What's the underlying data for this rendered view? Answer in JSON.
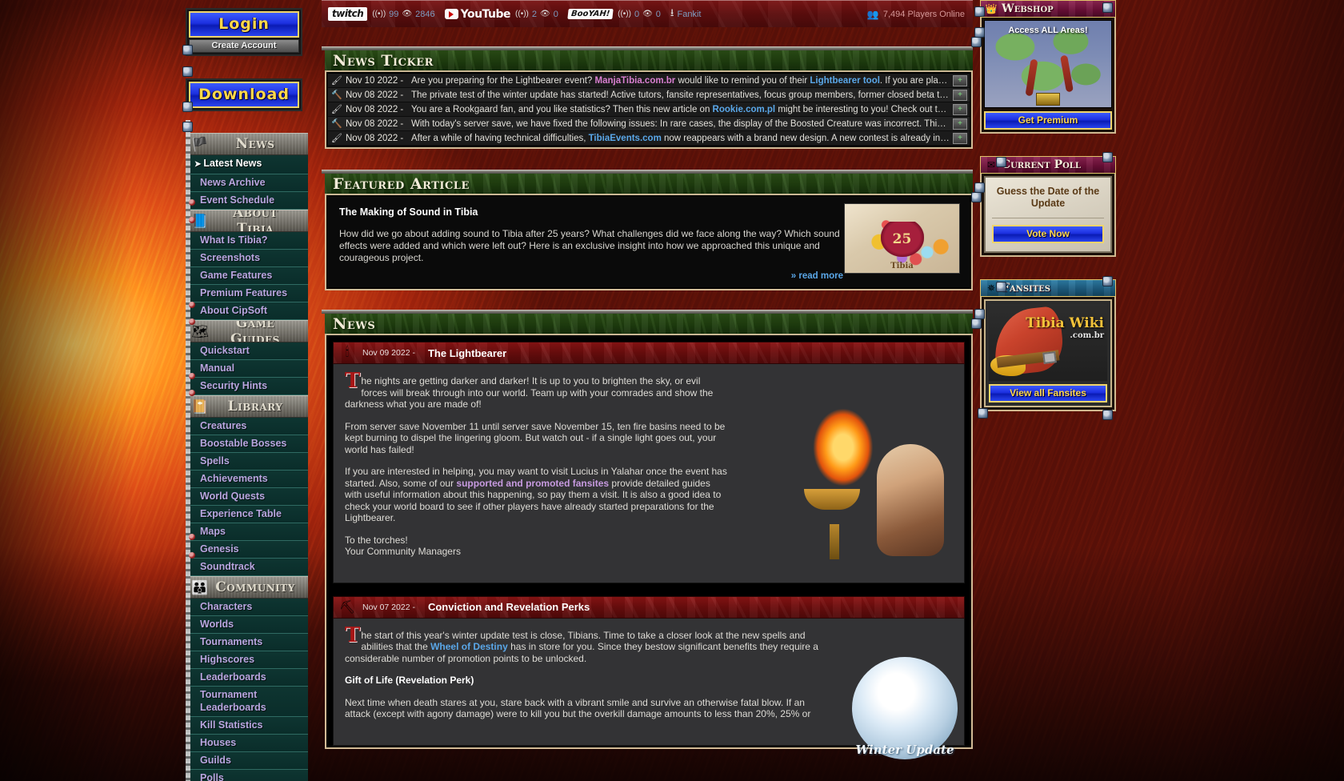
{
  "topbar": {
    "twitch_label": "twitch",
    "twitch_live": "99",
    "twitch_views": "2846",
    "youtube_label": "YouTube",
    "youtube_live": "2",
    "youtube_views": "0",
    "bigowatch_label": "BooYAH!",
    "bigowatch_live": "0",
    "bigowatch_views": "0",
    "fankit_label": "Fankit",
    "players_online": "7,494 Players Online",
    "live_icon": "broadcast-icon",
    "views_icon": "eye-icon",
    "download_icon": "download-icon",
    "players_icon": "people-icon"
  },
  "left_sidebar": {
    "login_label": "Login",
    "create_account_label": "Create Account",
    "download_label": "Download",
    "sections": [
      {
        "title": "News",
        "icon": "banner-icon",
        "items": [
          {
            "label": "Latest News",
            "active": true
          },
          {
            "label": "News Archive",
            "active": false
          },
          {
            "label": "Event Schedule",
            "active": false
          }
        ]
      },
      {
        "title": "About Tibia",
        "icon": "book-icon",
        "items": [
          {
            "label": "What Is Tibia?",
            "active": false
          },
          {
            "label": "Screenshots",
            "active": false
          },
          {
            "label": "Game Features",
            "active": false
          },
          {
            "label": "Premium Features",
            "active": false
          },
          {
            "label": "About CipSoft",
            "active": false
          }
        ]
      },
      {
        "title": "Game Guides",
        "icon": "map-icon",
        "items": [
          {
            "label": "Quickstart",
            "active": false
          },
          {
            "label": "Manual",
            "active": false
          },
          {
            "label": "Security Hints",
            "active": false
          }
        ]
      },
      {
        "title": "Library",
        "icon": "tome-icon",
        "items": [
          {
            "label": "Creatures",
            "active": false
          },
          {
            "label": "Boostable Bosses",
            "active": false
          },
          {
            "label": "Spells",
            "active": false
          },
          {
            "label": "Achievements",
            "active": false
          },
          {
            "label": "World Quests",
            "active": false
          },
          {
            "label": "Experience Table",
            "active": false
          },
          {
            "label": "Maps",
            "active": false
          },
          {
            "label": "Genesis",
            "active": false
          },
          {
            "label": "Soundtrack",
            "active": false
          }
        ]
      },
      {
        "title": "Community",
        "icon": "people-icon",
        "items": [
          {
            "label": "Characters",
            "active": false
          },
          {
            "label": "Worlds",
            "active": false
          },
          {
            "label": "Tournaments",
            "active": false
          },
          {
            "label": "Highscores",
            "active": false
          },
          {
            "label": "Leaderboards",
            "active": false
          },
          {
            "label": "Tournament Leaderboards",
            "active": false
          },
          {
            "label": "Kill Statistics",
            "active": false
          },
          {
            "label": "Houses",
            "active": false
          },
          {
            "label": "Guilds",
            "active": false
          },
          {
            "label": "Polls",
            "active": false
          }
        ]
      }
    ]
  },
  "news_ticker": {
    "title": "News Ticker",
    "rows": [
      {
        "icon": "quill-icon",
        "date": "Nov 10 2022 -",
        "pre": "Are you preparing for the Lightbearer event? ",
        "link1": "ManjaTibia.com.br",
        "link1_style": "pink",
        "mid": " would like to remind you of their ",
        "link2": "Lightbearer tool",
        "post": ". If you are plan…"
      },
      {
        "icon": "hammer-icon",
        "date": "Nov 08 2022 -",
        "pre": "The private test of the winter update has started! Active tutors, fansite representatives, focus group members, former closed beta t…",
        "link1": "",
        "mid": "",
        "link2": "",
        "post": ""
      },
      {
        "icon": "quill-icon",
        "date": "Nov 08 2022 -",
        "pre": "You are a Rookgaard fan, and you like statistics? Then this new article on ",
        "link1": "Rookie.com.pl",
        "link1_style": "blue",
        "mid": " might be interesting to you! Check out th…",
        "link2": "",
        "post": ""
      },
      {
        "icon": "hammer-icon",
        "date": "Nov 08 2022 -",
        "pre": "With today's server save, we have fixed the following issues: In rare cases, the display of the Boosted Creature was incorrect. This…",
        "link1": "",
        "mid": "",
        "link2": "",
        "post": ""
      },
      {
        "icon": "quill-icon",
        "date": "Nov 08 2022 -",
        "pre": "After a while of having technical difficulties, ",
        "link1": "TibiaEvents.com",
        "link1_style": "blue",
        "mid": " now reappears with a brand new design. A new contest is already in …",
        "link2": "",
        "post": ""
      }
    ],
    "row_button": "+"
  },
  "featured_article": {
    "title": "Featured Article",
    "headline": "The Making of Sound in Tibia",
    "body": "How did we go about adding sound to Tibia after 25 years? What challenges did we face along the way? Which sound effects were added and which were left out? Here is an exclusive insight into how we approached this unique and courageous project.",
    "read_more": "» read more",
    "image_caption": "Tibia",
    "image_badge": "25"
  },
  "news": {
    "title": "News",
    "articles": [
      {
        "icon": "lightbearer-icon",
        "date": "Nov 09 2022 -",
        "title": "The Lightbearer",
        "dropcap": "T",
        "p1_rest": "he nights are getting darker and darker! It is up to you to brighten the sky, or evil forces will break through into our world. Team up with your comrades and show the darkness what you are made of!",
        "p2": "From server save November 11 until server save November 15, ten fire basins need to be kept burning to dispel the lingering gloom. But watch out - if a single light goes out, your world has failed!",
        "p3_pre": "If you are interested in helping, you may want to visit Lucius in Yalahar once the event has started. Also, some of our ",
        "p3_link": "supported and promoted fansites",
        "p3_post": " provide detailed guides with useful information about this happening, so pay them a visit. It is also a good idea to check your world board to see if other players have already started preparations for the Lightbearer.",
        "p4": "To the torches!",
        "p5": "Your Community Managers"
      },
      {
        "icon": "perk-icon",
        "date": "Nov 07 2022 -",
        "title": "Conviction and Revelation Perks",
        "dropcap": "T",
        "p1_pre": "he start of this year's winter update test is close, Tibians. Time to take a closer look at the new spells and abilities that the ",
        "p1_link": "Wheel of Destiny",
        "p1_post": " has in store for you. Since they bestow significant benefits they require a considerable number of promotion points to be unlocked.",
        "subhead": "Gift of Life (Revelation Perk)",
        "p2": "Next time when death stares at you, stare back with a vibrant smile and survive an otherwise fatal blow. If an attack (except with agony damage) were to kill you but the overkill damage amounts to less than 20%, 25% or",
        "image_caption": "Winter Update"
      }
    ]
  },
  "right_sidebar": {
    "webshop": {
      "title": "Webshop",
      "icon": "crown-icon",
      "image_text": "Access ALL Areas!",
      "button_label": "Get Premium"
    },
    "poll": {
      "title": "Current Poll",
      "icon": "envelope-icon",
      "question": "Guess the Date of the Update",
      "button_label": "Vote Now"
    },
    "fansites": {
      "title": "Fansites",
      "icon": "star-icon",
      "site_name": "Tibia",
      "site_name2": "Wiki",
      "site_tld": ".com.br",
      "button_label": "View all Fansites"
    }
  },
  "colors": {
    "accent_link": "#5aa7e8",
    "accent_pink": "#d87fd0",
    "menu_text": "#b9a6e0",
    "banner_green": "#20400f",
    "banner_red": "#6d0d0d",
    "button_blue": "#1c30e0",
    "button_gold": "#ffd84a"
  }
}
